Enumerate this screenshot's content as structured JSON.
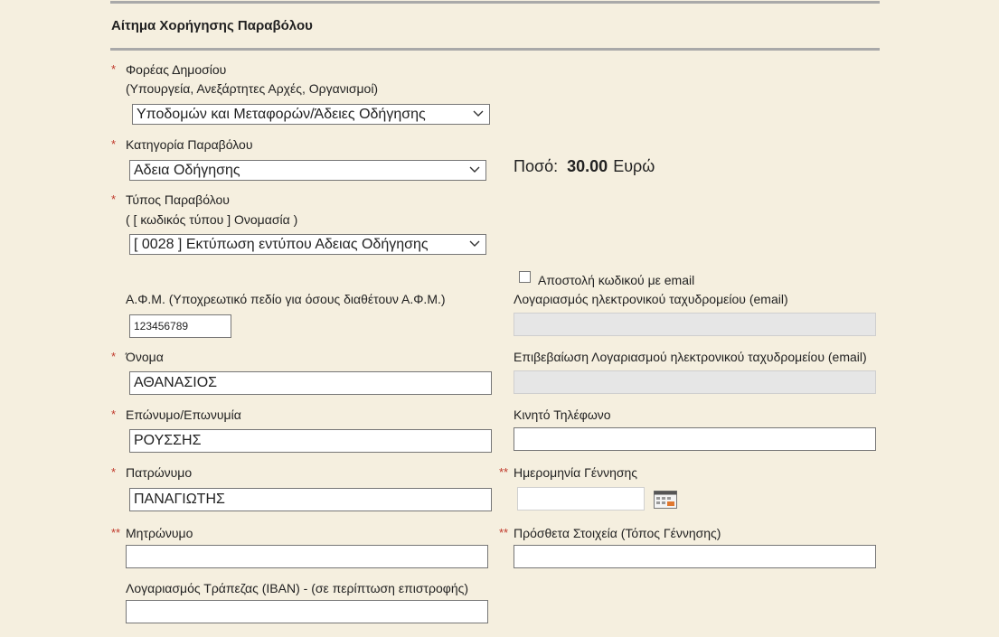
{
  "form": {
    "title": "Αίτημα Χορήγησης Παραβόλου",
    "required_mark": "*",
    "double_required_mark": "**",
    "agency": {
      "label": "Φορέας Δημοσίου",
      "sublabel": "(Υπουργεία, Ανεξάρτητες Αρχές, Οργανισμοί)",
      "value": "Υποδομών και Μεταφορών/Άδειες Οδήγησης"
    },
    "category": {
      "label": "Κατηγορία Παραβόλου",
      "value": "Αδεια Οδήγησης"
    },
    "amount": {
      "label": "Ποσό:",
      "value": "30.00",
      "currency": "Ευρώ"
    },
    "fee_type": {
      "label": "Τύπος Παραβόλου",
      "sublabel": "( [ κωδικός τύπου ] Ονομασία )",
      "value": "[ 0028 ] Εκτύπωση εντύπου Αδειας Οδήγησης"
    },
    "afm": {
      "label": "Α.Φ.Μ. (Υποχρεωτικό πεδίο για όσους διαθέτουν Α.Φ.Μ.)",
      "value": "123456789"
    },
    "send_code_email": {
      "label": "Αποστολή κωδικού με email",
      "checked": false
    },
    "email": {
      "label": "Λογαριασμός ηλεκτρονικού ταχυδρομείου (email)",
      "value": ""
    },
    "email_confirm": {
      "label": "Επιβεβαίωση Λογαριασμού ηλεκτρονικού ταχυδρομείου (email)",
      "value": ""
    },
    "first_name": {
      "label": "Όνομα",
      "value": "ΑΘΑΝΑΣΙΟΣ"
    },
    "last_name": {
      "label": "Επώνυμο/Επωνυμία",
      "value": "ΡΟΥΣΣΗΣ"
    },
    "mobile": {
      "label": "Κινητό Τηλέφωνο",
      "value": ""
    },
    "father_name": {
      "label": "Πατρώνυμο",
      "value": "ΠΑΝΑΓΙΩΤΗΣ"
    },
    "birth_date": {
      "label": "Ημερομηνία Γέννησης",
      "value": ""
    },
    "mother_name": {
      "label": "Μητρώνυμο",
      "value": ""
    },
    "extra_info": {
      "label": "Πρόσθετα Στοιχεία (Τόπος Γέννησης)",
      "value": ""
    },
    "iban": {
      "label": "Λογαριασμός Τράπεζας (IBAN) - (σε περίπτωση επιστροφής)",
      "value": ""
    }
  },
  "colors": {
    "background": "#f5efdf",
    "required": "#c0392b",
    "rule": "#a9a9a9",
    "disabled_field": "#e6e6e6"
  },
  "icons": {
    "select_arrow": "chevron-down-icon",
    "date_picker": "calendar-icon"
  }
}
